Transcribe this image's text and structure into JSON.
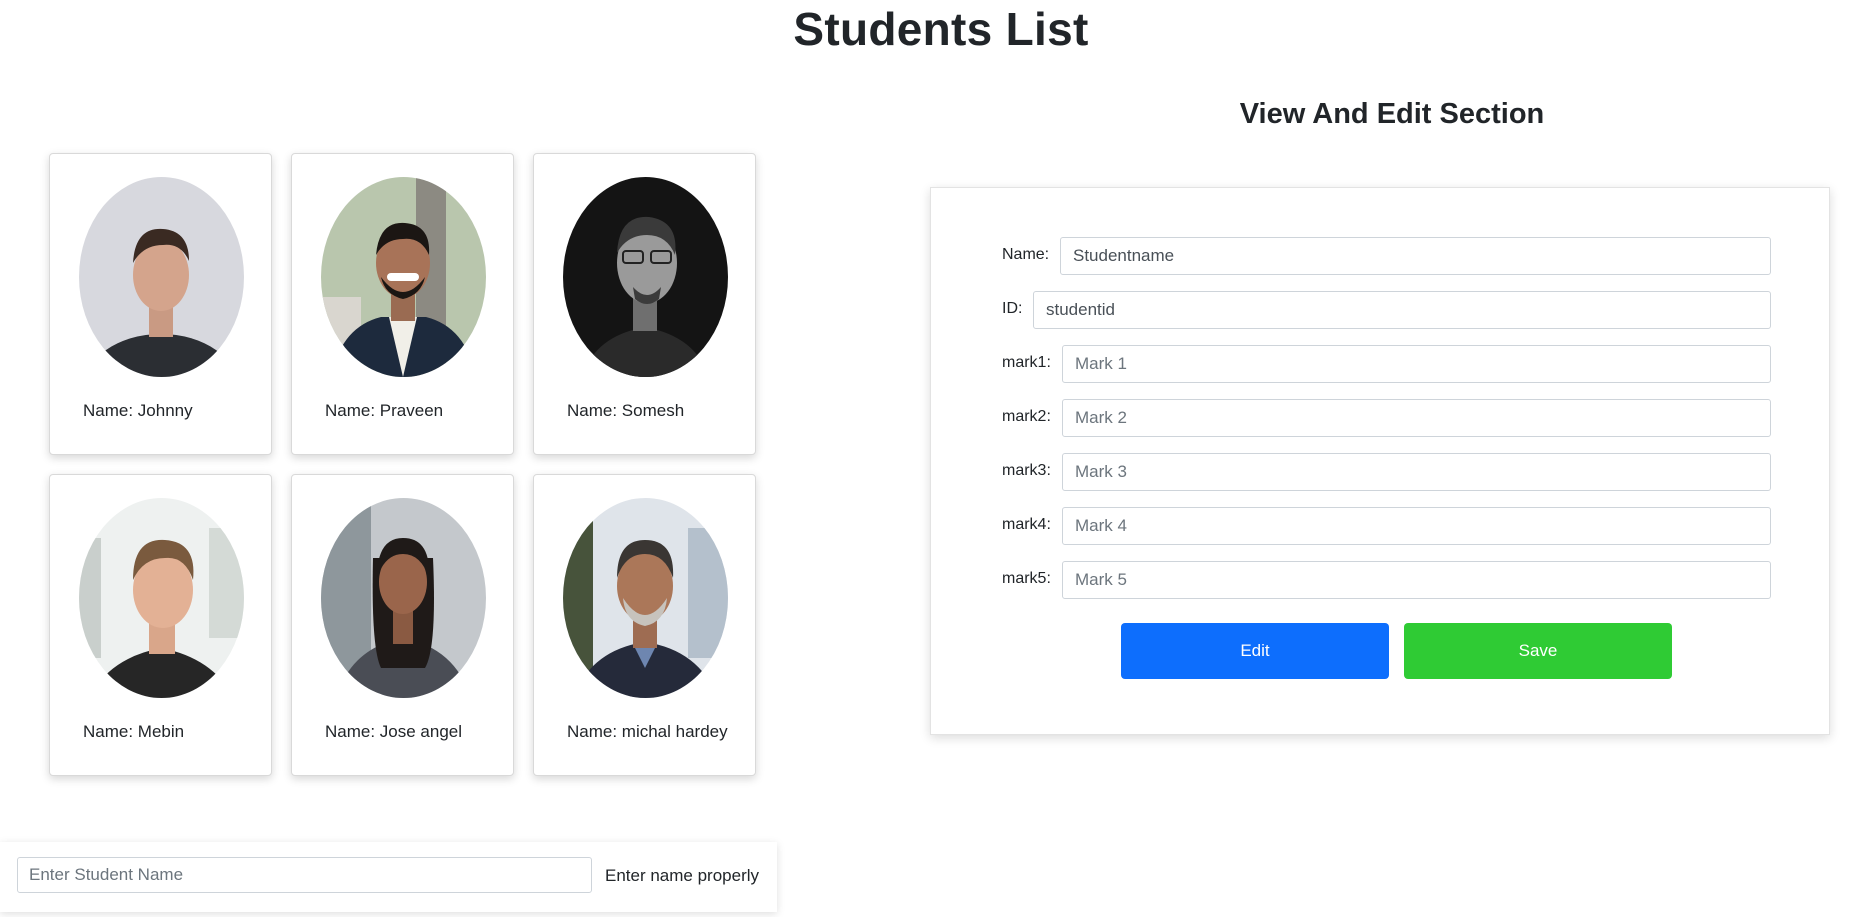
{
  "page": {
    "title": "Students List"
  },
  "students": [
    {
      "label": "Name: Johnny"
    },
    {
      "label": "Name: Praveen"
    },
    {
      "label": "Name: Somesh"
    },
    {
      "label": "Name: Mebin"
    },
    {
      "label": "Name: Jose angel"
    },
    {
      "label": "Name: michal hardey"
    }
  ],
  "search": {
    "placeholder": "Enter Student Name",
    "hint": "Enter name properly"
  },
  "edit_section": {
    "title": "View And Edit Section",
    "fields": [
      {
        "label": "Name:",
        "value": "Studentname",
        "placeholder": ""
      },
      {
        "label": "ID:",
        "value": "studentid",
        "placeholder": ""
      },
      {
        "label": "mark1:",
        "value": "",
        "placeholder": "Mark 1"
      },
      {
        "label": "mark2:",
        "value": "",
        "placeholder": "Mark 2"
      },
      {
        "label": "mark3:",
        "value": "",
        "placeholder": "Mark 3"
      },
      {
        "label": "mark4:",
        "value": "",
        "placeholder": "Mark 4"
      },
      {
        "label": "mark5:",
        "value": "",
        "placeholder": "Mark 5"
      }
    ],
    "edit_label": "Edit",
    "save_label": "Save"
  },
  "colors": {
    "edit_button": "#0d6efd",
    "save_button": "#2fcb34"
  }
}
